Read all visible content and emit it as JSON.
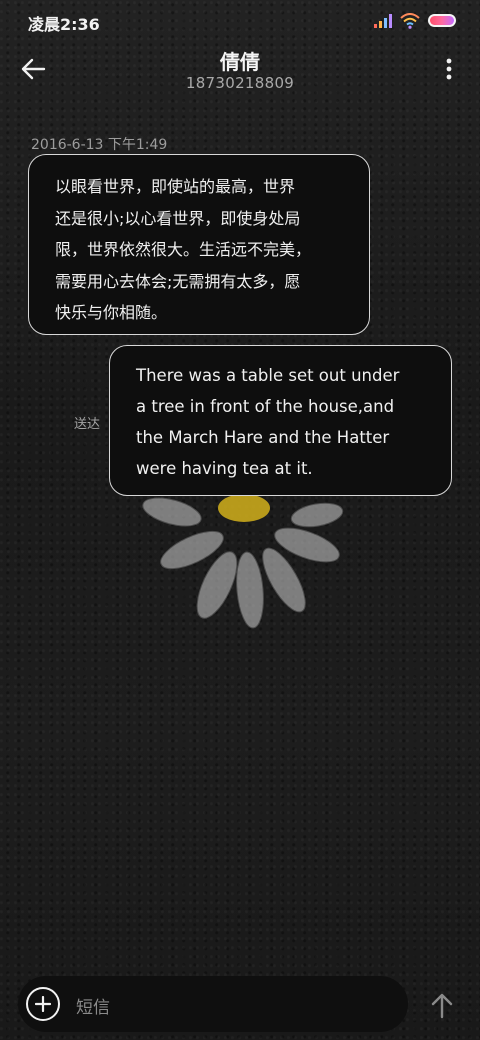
{
  "status_bar": {
    "time": "凌晨2:36",
    "icons": [
      "signal-icon",
      "wifi-icon",
      "battery-icon"
    ],
    "battery_colors": [
      "#ff4f6a",
      "#ff6aa0",
      "#c46bff"
    ]
  },
  "header": {
    "contact_name": "倩倩",
    "contact_number": "18730218809",
    "back_icon": "arrow-left-icon",
    "more_icon": "vertical-dots-icon"
  },
  "conversation": {
    "timestamp": "2016-6-13 下午1:49",
    "messages": [
      {
        "direction": "incoming",
        "lines": [
          "以眼看世界，即使站的最高，世界",
          "还是很小;以心看世界，即使身处局",
          "限，世界依然很大。生活远不完美，",
          "需要用心去体会;无需拥有太多，愿",
          "快乐与你相随。"
        ]
      },
      {
        "direction": "outgoing",
        "status": "送达",
        "lines": [
          "There was a table set out under",
          "a tree in front of the house,and",
          "the March Hare and the Hatter",
          "were having tea at it."
        ]
      }
    ]
  },
  "composer": {
    "placeholder": "短信",
    "add_icon": "plus-icon",
    "send_icon": "arrow-up-icon"
  },
  "colors": {
    "bubble_background": "#0e0e0e",
    "bubble_border": "#d8d8d8",
    "background": "#1b1b1b"
  }
}
